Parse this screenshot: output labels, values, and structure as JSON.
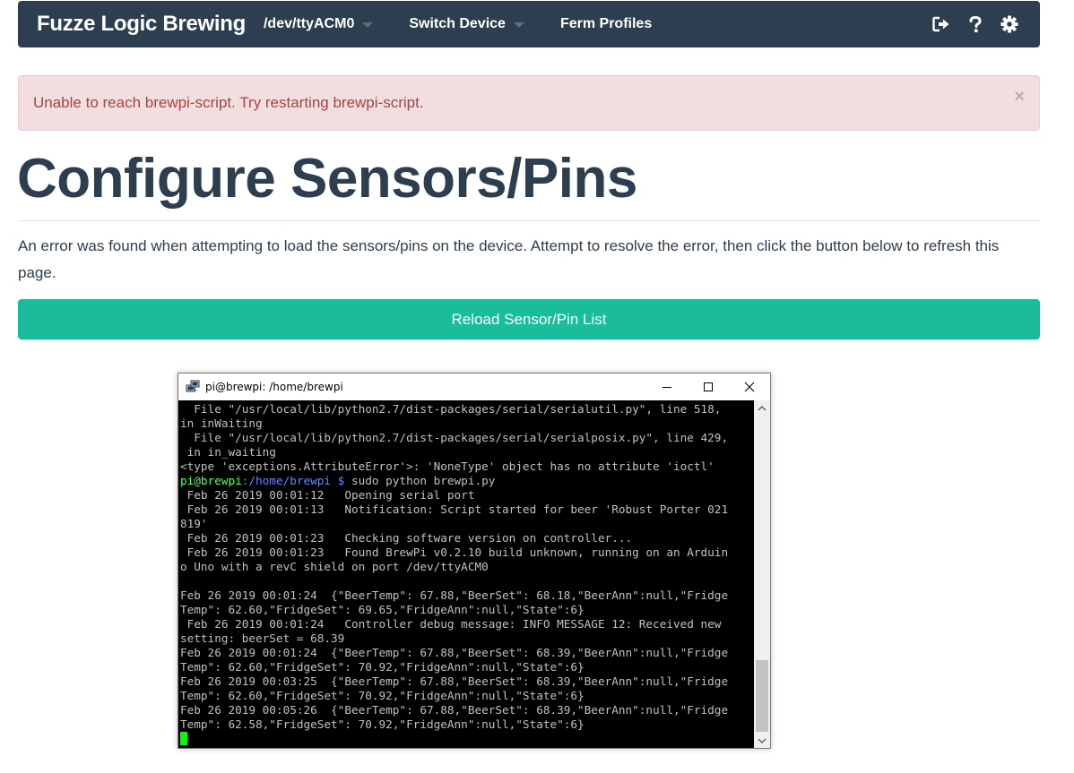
{
  "navbar": {
    "brand": "Fuzze Logic Brewing",
    "device": "/dev/ttyACM0",
    "switch_device": "Switch Device",
    "ferm_profiles": "Ferm Profiles",
    "icons": [
      "sign-out-icon",
      "help-icon",
      "gear-icon"
    ],
    "bg_color": "#2c3e50"
  },
  "alert": {
    "message": "Unable to reach brewpi-script. Try restarting brewpi-script.",
    "close": "×"
  },
  "page": {
    "title": "Configure Sensors/Pins",
    "description": "An error was found when attempting to load the sensors/pins on the device. Attempt to resolve the error, then click the button below to refresh this page.",
    "reload_label": "Reload Sensor/Pin List",
    "accent_color": "#1abc9c"
  },
  "terminal": {
    "title": "pi@brewpi: /home/brewpi",
    "lines": [
      "  File \"/usr/local/lib/python2.7/dist-packages/serial/serialutil.py\", line 518,",
      "in inWaiting",
      "  File \"/usr/local/lib/python2.7/dist-packages/serial/serialposix.py\", line 429,",
      " in in_waiting",
      "<type 'exceptions.AttributeError'>: 'NoneType' object has no attribute 'ioctl'"
    ],
    "prompt_user": "pi@brewpi",
    "prompt_path": ":/home/brewpi $",
    "prompt_cmd": " sudo python brewpi.py",
    "output": [
      " Feb 26 2019 00:01:12   Opening serial port",
      " Feb 26 2019 00:01:13   Notification: Script started for beer 'Robust Porter 021",
      "819'",
      " Feb 26 2019 00:01:23   Checking software version on controller...",
      " Feb 26 2019 00:01:23   Found BrewPi v0.2.10 build unknown, running on an Arduin",
      "o Uno with a revC shield on port /dev/ttyACM0",
      "",
      "Feb 26 2019 00:01:24  {\"BeerTemp\": 67.88,\"BeerSet\": 68.18,\"BeerAnn\":null,\"Fridge",
      "Temp\": 62.60,\"FridgeSet\": 69.65,\"FridgeAnn\":null,\"State\":6}",
      " Feb 26 2019 00:01:24   Controller debug message: INFO MESSAGE 12: Received new",
      "setting: beerSet = 68.39",
      "Feb 26 2019 00:01:24  {\"BeerTemp\": 67.88,\"BeerSet\": 68.39,\"BeerAnn\":null,\"Fridge",
      "Temp\": 62.60,\"FridgeSet\": 70.92,\"FridgeAnn\":null,\"State\":6}",
      "Feb 26 2019 00:03:25  {\"BeerTemp\": 67.88,\"BeerSet\": 68.39,\"BeerAnn\":null,\"Fridge",
      "Temp\": 62.60,\"FridgeSet\": 70.92,\"FridgeAnn\":null,\"State\":6}",
      "Feb 26 2019 00:05:26  {\"BeerTemp\": 67.88,\"BeerSet\": 68.39,\"BeerAnn\":null,\"Fridge",
      "Temp\": 62.58,\"FridgeSet\": 70.92,\"FridgeAnn\":null,\"State\":6}"
    ],
    "cursor_color": "#00ff00"
  }
}
